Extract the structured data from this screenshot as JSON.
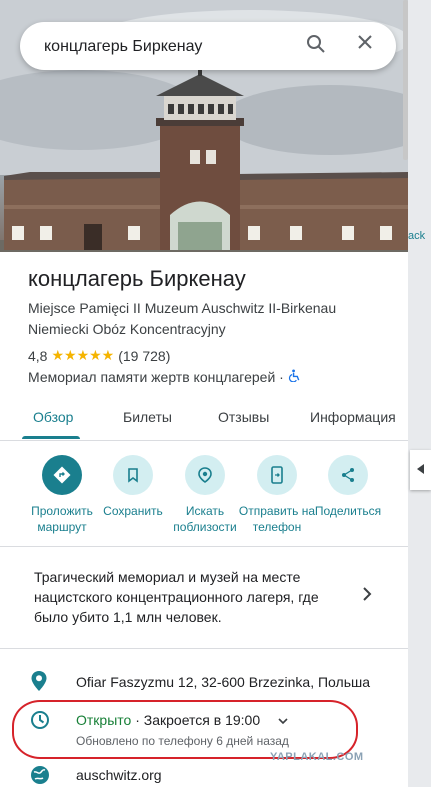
{
  "search": {
    "value": "концлагерь Биркенау",
    "search_icon": "search-icon",
    "close_icon": "close-icon"
  },
  "place": {
    "title": "концлагерь Биркенау",
    "subtitle": "Miejsce Pamięci II Muzeum Auschwitz II-Birkenau Niemiecki Obóz Koncentracyjny",
    "rating": "4,8",
    "stars": "★★★★★",
    "reviews": "(19 728)",
    "category": "Мемориал памяти жертв концлагерей ·",
    "accessibility_icon": "wheelchair-icon"
  },
  "tabs": [
    {
      "label": "Обзор",
      "active": true
    },
    {
      "label": "Билеты"
    },
    {
      "label": "Отзывы"
    },
    {
      "label": "Информация"
    }
  ],
  "actions": [
    {
      "label": "Проложить маршрут",
      "icon": "directions-icon"
    },
    {
      "label": "Сохранить",
      "icon": "bookmark-icon"
    },
    {
      "label": "Искать поблизости",
      "icon": "nearby-icon"
    },
    {
      "label": "Отправить на телефон",
      "icon": "send-to-phone-icon"
    },
    {
      "label": "Поделиться",
      "icon": "share-icon"
    }
  ],
  "description": "Трагический мемориал и музей на месте нацистского концентрационного лагеря, где было убито 1,1 млн человек.",
  "address": "Ofiar Faszyzmu 12, 32-600 Brzezinka, Польша",
  "hours": {
    "status": "Открыто",
    "closes": "· Закроется в 19:00",
    "updated": "Обновлено по телефону 6 дней назад"
  },
  "website": "auschwitz.org",
  "watermark": "YAPLAKAL.COM",
  "map_label_fragment": "ack",
  "colors": {
    "accent": "#1a7f8e",
    "open": "#188038",
    "highlight": "#d6232a",
    "star": "#f5b400"
  }
}
